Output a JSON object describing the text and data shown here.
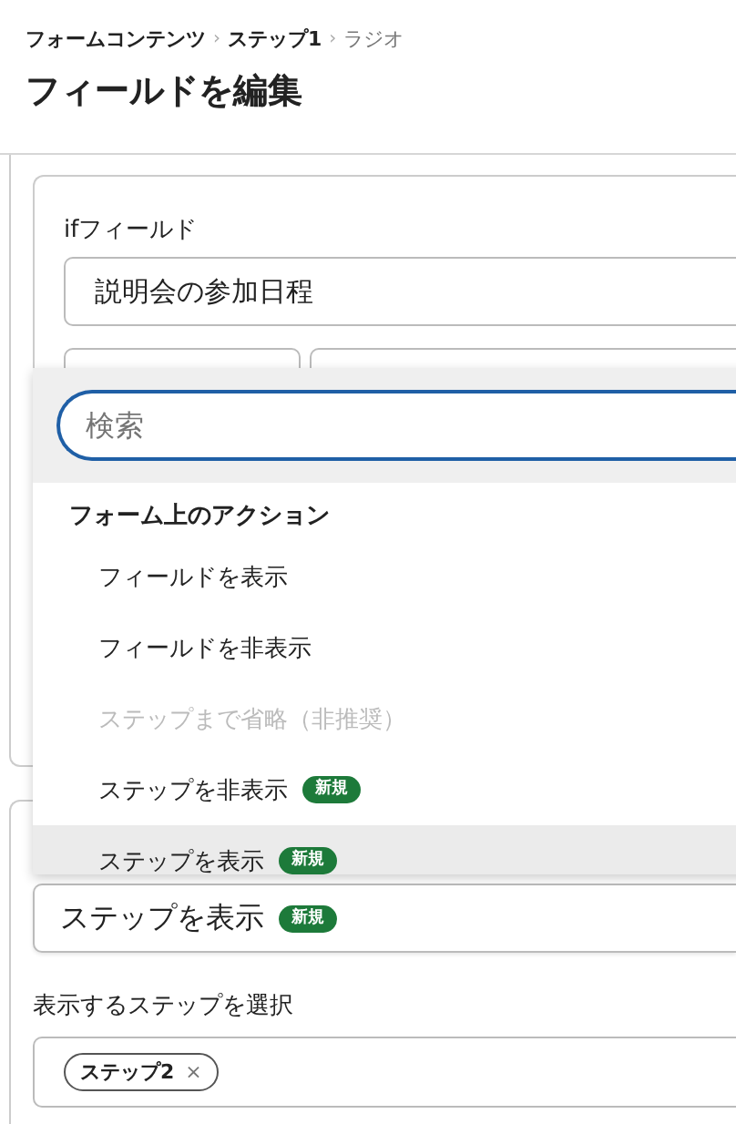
{
  "breadcrumb": {
    "separator": "›",
    "items": [
      {
        "label": "フォームコンテンツ",
        "current": false
      },
      {
        "label": "ステップ1",
        "current": false
      },
      {
        "label": "ラジオ",
        "current": true
      }
    ]
  },
  "title": "フィールドを編集",
  "if_field": {
    "label": "ifフィールド",
    "value": "説明会の参加日程"
  },
  "dropdown": {
    "search": {
      "placeholder": "検索"
    },
    "items": [
      {
        "kind": "heading",
        "label": "フォーム上のアクション"
      },
      {
        "kind": "option",
        "label": "フィールドを表示",
        "disabled": false,
        "selected": false
      },
      {
        "kind": "option",
        "label": "フィールドを非表示",
        "disabled": false,
        "selected": false
      },
      {
        "kind": "option",
        "label": "ステップまで省略（非推奨）",
        "disabled": true,
        "selected": false
      },
      {
        "kind": "option",
        "label": "ステップを非表示",
        "disabled": false,
        "selected": false,
        "badge": "新規"
      },
      {
        "kind": "option",
        "label": "ステップを表示",
        "disabled": false,
        "selected": true,
        "badge": "新規"
      }
    ]
  },
  "action_select": {
    "value": "ステップを表示",
    "badge": "新規"
  },
  "step_select": {
    "label": "表示するステップを選択",
    "chips": [
      {
        "label": "ステップ2",
        "remove": "×"
      }
    ]
  }
}
